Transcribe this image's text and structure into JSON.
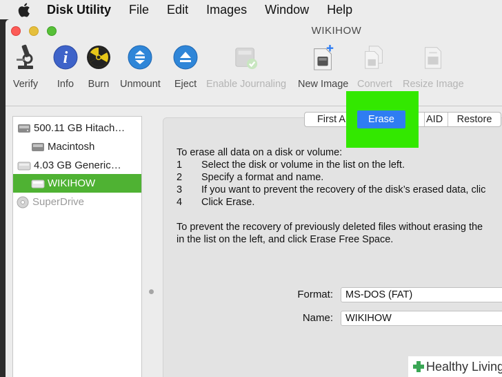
{
  "menubar": {
    "apple": "apple-icon",
    "app_name": "Disk Utility",
    "items": [
      "File",
      "Edit",
      "Images",
      "Window",
      "Help"
    ]
  },
  "window": {
    "title": "WIKIHOW"
  },
  "toolbar": {
    "verify": "Verify",
    "info": "Info",
    "burn": "Burn",
    "unmount": "Unmount",
    "eject": "Eject",
    "enable_journaling": "Enable Journaling",
    "new_image": "New Image",
    "convert": "Convert",
    "resize_image": "Resize Image"
  },
  "sidebar": {
    "items": [
      {
        "label": "500.11 GB Hitach…",
        "icon": "hard-drive-icon"
      },
      {
        "label": "Macintosh",
        "icon": "volume-icon"
      },
      {
        "label": "4.03 GB Generic…",
        "icon": "usb-drive-icon"
      },
      {
        "label": "WIKIHOW",
        "icon": "volume-icon"
      },
      {
        "label": "SuperDrive",
        "icon": "optical-drive-icon"
      }
    ],
    "selected_index": 3
  },
  "tabs": {
    "first_aid": "First A",
    "erase": "Erase",
    "raid": "AID",
    "restore": "Restore"
  },
  "instructions": {
    "intro": "To erase all data on a disk or volume:",
    "steps": [
      {
        "n": "1",
        "text": "Select the disk or volume in the list on the left."
      },
      {
        "n": "2",
        "text": "Specify a format and name."
      },
      {
        "n": "3",
        "text": "If you want to prevent the recovery of the disk’s erased data, clic"
      },
      {
        "n": "4",
        "text": "Click Erase."
      }
    ],
    "para2_line1": "To prevent the recovery of previously deleted files without erasing the",
    "para2_line2": "in the list on the left, and click Erase Free Space."
  },
  "form": {
    "format_label": "Format:",
    "format_value": "MS-DOS (FAT)",
    "name_label": "Name:",
    "name_value": "WIKIHOW"
  },
  "watermark": {
    "text": "Healthy Living"
  },
  "colors": {
    "selection": "#4fb233",
    "highlight": "#33e800",
    "accent_blue": "#2f7df2"
  }
}
